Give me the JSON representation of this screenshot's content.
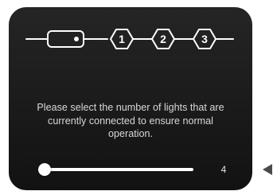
{
  "stepper": {
    "steps": [
      "1",
      "2",
      "3"
    ]
  },
  "message": "Please select the number of lights that are currently connected to ensure normal operation.",
  "slider": {
    "value": "4"
  },
  "colors": {
    "panel": "#1c1c1c",
    "text": "#d8d8d8",
    "accent": "#ffffff"
  }
}
